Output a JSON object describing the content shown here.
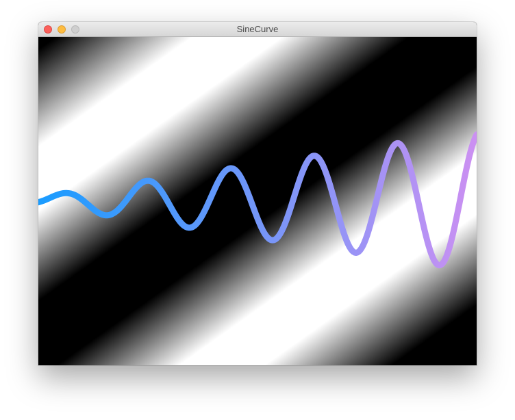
{
  "window": {
    "title": "SineCurve"
  },
  "icons": {
    "close": "close-button",
    "minimize": "minimize-button",
    "zoom": "zoom-button-disabled"
  },
  "colors": {
    "close": "#fc605b",
    "minimize": "#fdbc40",
    "zoom": "#cfcfcf",
    "curve_start": "#1a9cff",
    "curve_end": "#cc90f2",
    "background_dark": "#000000",
    "background_light": "#ffffff"
  }
}
